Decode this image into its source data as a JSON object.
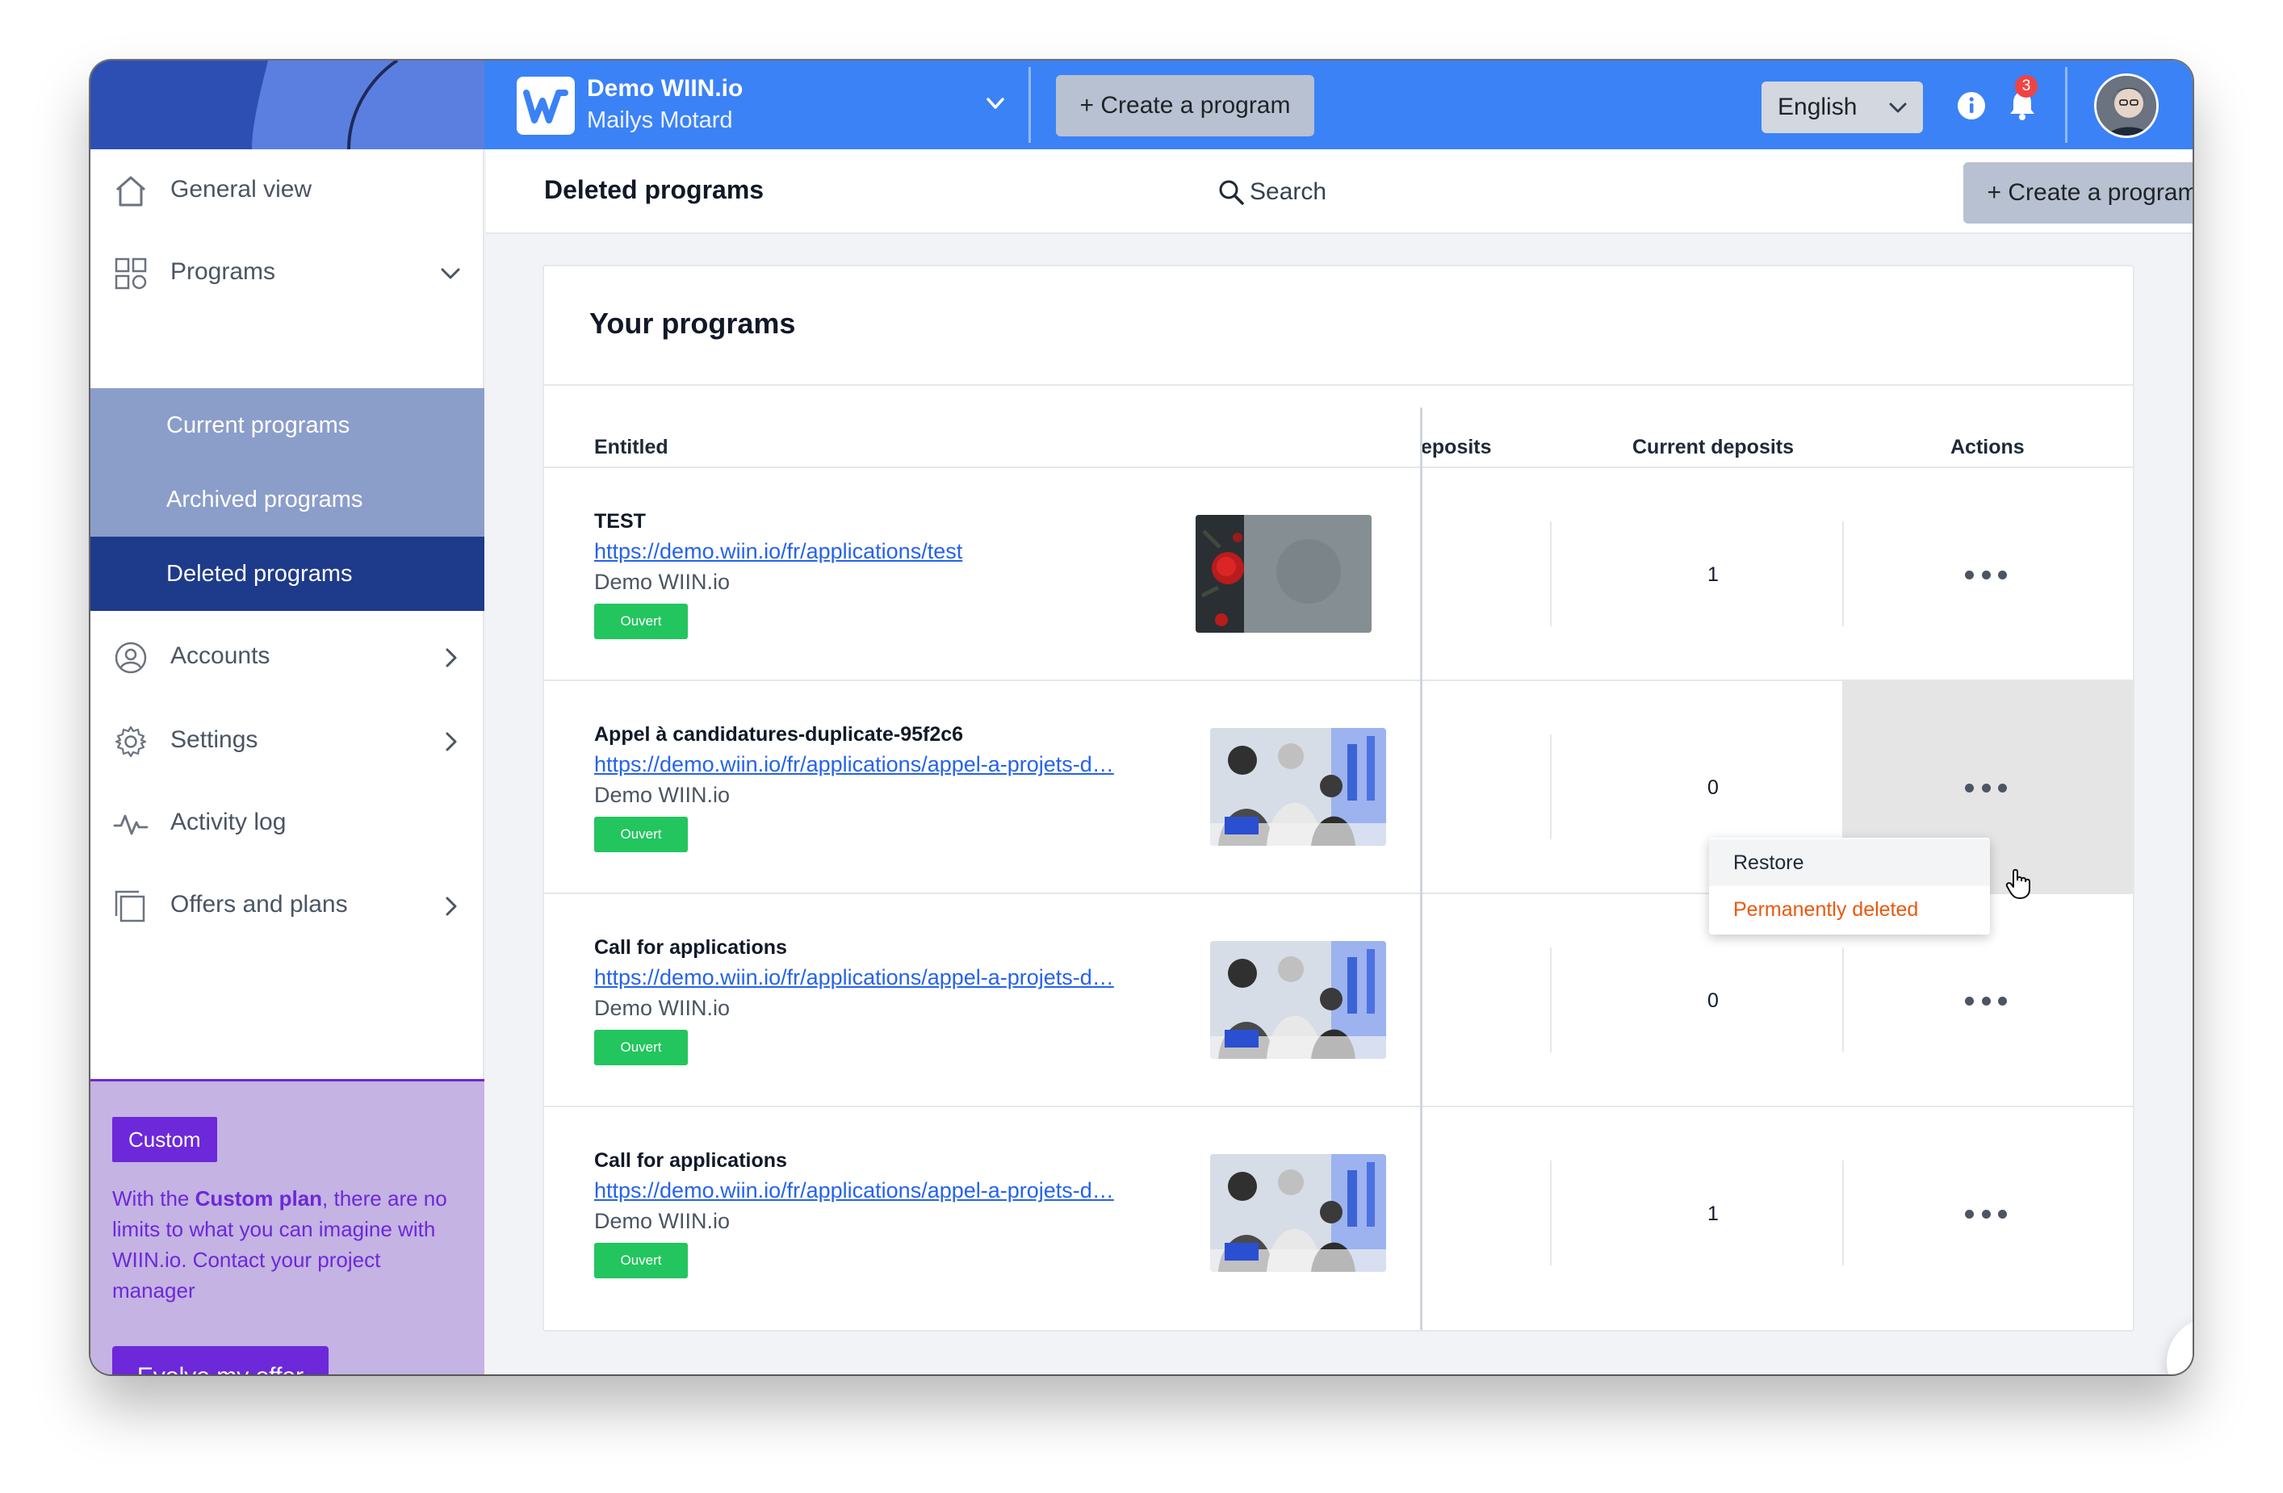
{
  "topbar": {
    "org_name": "Demo WIIN.io",
    "org_user": "Mailys Motard",
    "create_button": "+ Create a program",
    "language": "English",
    "notifications_count": "3"
  },
  "sidebar": {
    "items": [
      {
        "label": "General view",
        "icon": "home-icon"
      },
      {
        "label": "Programs",
        "icon": "grid-icon"
      },
      {
        "label": "Accounts",
        "icon": "user-circle-icon"
      },
      {
        "label": "Settings",
        "icon": "gear-icon"
      },
      {
        "label": "Activity log",
        "icon": "activity-icon"
      },
      {
        "label": "Offers and plans",
        "icon": "copy-icon"
      }
    ],
    "subitems": [
      {
        "label": "Current programs"
      },
      {
        "label": "Archived programs"
      },
      {
        "label": "Deleted programs",
        "active": true
      }
    ],
    "promo": {
      "badge": "Custom",
      "text_before": "With the ",
      "text_bold": "Custom plan",
      "text_after": ", there are no limits to what you can imagine with WIIN.io. Contact your project manager",
      "button": "Evolve my offer"
    }
  },
  "header": {
    "title": "Deleted programs",
    "search_placeholder": "Search",
    "create_button": "+ Create a program"
  },
  "card": {
    "title": "Your programs",
    "columns": [
      "Entitled",
      "eposits",
      "Current deposits",
      "Actions"
    ],
    "rows": [
      {
        "title": "TEST",
        "link": "https://demo.wiin.io/fr/applications/test",
        "org": "Demo WIIN.io",
        "status": "Ouvert",
        "current_deposits": "1",
        "image": "roses-thumbnail"
      },
      {
        "title": "Appel à candidatures-duplicate-95f2c6",
        "link": "https://demo.wiin.io/fr/applications/appel-a-projets-d…",
        "org": "Demo WIIN.io",
        "status": "Ouvert",
        "current_deposits": "0",
        "image": "team-meeting-thumbnail"
      },
      {
        "title": "Call for applications",
        "link": "https://demo.wiin.io/fr/applications/appel-a-projets-d…",
        "org": "Demo WIIN.io",
        "status": "Ouvert",
        "current_deposits": "0",
        "image": "team-meeting-thumbnail"
      },
      {
        "title": "Call for applications",
        "link": "https://demo.wiin.io/fr/applications/appel-a-projets-d…",
        "org": "Demo WIIN.io",
        "status": "Ouvert",
        "current_deposits": "1",
        "image": "team-meeting-thumbnail"
      }
    ],
    "menu": {
      "restore": "Restore",
      "delete": "Permanently deleted"
    }
  },
  "help": {
    "icon": "victory-hand-icon",
    "glyph": "✌️"
  },
  "colors": {
    "topbar": "#3b82f6",
    "sidebar_sub": "#8b9dc9",
    "sidebar_active": "#1e3a8a",
    "promo_bg": "#c4b3e3",
    "promo_accent": "#6d28d9",
    "status_green": "#22c55e",
    "danger": "#ea580c"
  }
}
